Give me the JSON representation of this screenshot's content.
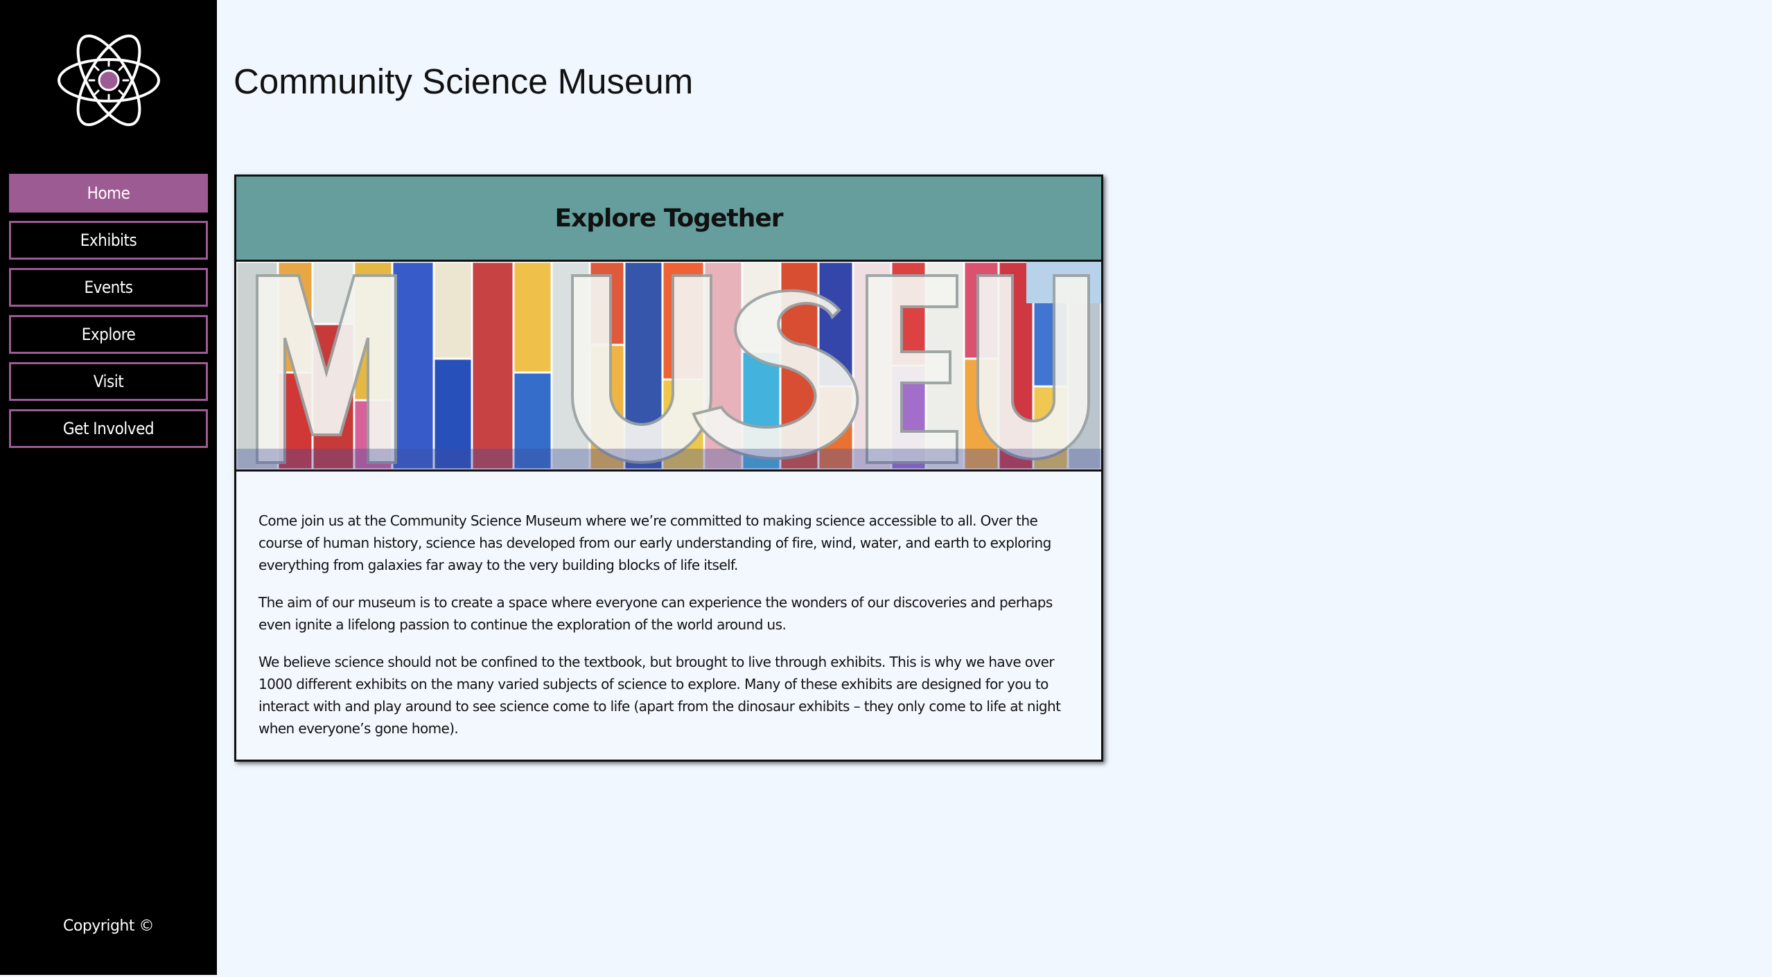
{
  "site": {
    "title": "Community Science Museum",
    "logo_icon": "atom-icon",
    "accent_color": "#9c5b93",
    "header_color": "#659e9d"
  },
  "nav": {
    "items": [
      {
        "label": "Home",
        "active": true
      },
      {
        "label": "Exhibits",
        "active": false
      },
      {
        "label": "Events",
        "active": false
      },
      {
        "label": "Explore",
        "active": false
      },
      {
        "label": "Visit",
        "active": false
      },
      {
        "label": "Get Involved",
        "active": false
      }
    ]
  },
  "card": {
    "title": "Explore Together",
    "banner_image": "museum-letters-image",
    "paragraphs": [
      "Come join us at the Community Science Museum where we’re committed to making science accessible to all. Over the course of human history, science has developed from our early understanding of fire, wind, water, and earth to exploring everything from galaxies far away to the very building blocks of life itself.",
      "The aim of our museum is to create a space where everyone can experience the wonders of our discoveries and perhaps even ignite a lifelong passion to continue the exploration of the world around us.",
      "We believe science should not be confined to the textbook, but brought to live through exhibits. This is why we have over 1000 different exhibits on the many varied subjects of science to explore. Many of these exhibits are designed for you to interact with and play around to see science come to life (apart from the dinosaur exhibits – they only come to life at night when everyone’s gone home)."
    ]
  },
  "footer": {
    "copyright": "Copyright ©"
  }
}
